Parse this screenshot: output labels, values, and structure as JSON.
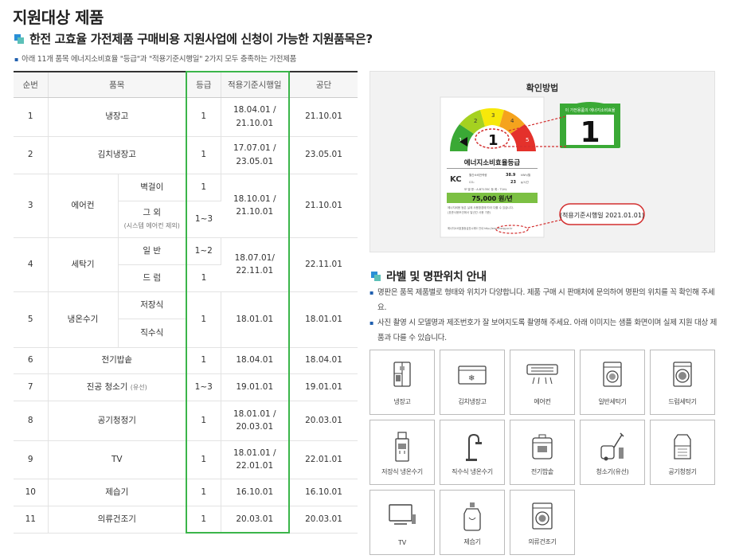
{
  "page": {
    "title": "지원대상 제품",
    "subtitle": "한전 고효율 가전제품 구매비용 지원사업에 신청이 가능한 지원품목은?",
    "note": "아래 11개 품목 에너지소비효율 \"등급\"과 \"적용기준시행일\" 2가지 모두 충족하는 가전제품"
  },
  "table": {
    "headers": [
      "순번",
      "품목",
      "등급",
      "적용기준시행일",
      "공단"
    ],
    "rows": [
      {
        "no": "1",
        "item": "냉장고",
        "grade": "1",
        "date": "18.04.01 / 21.10.01",
        "date1": "18.04.01 /",
        "date2": "21.10.01",
        "agency": "21.10.01"
      },
      {
        "no": "2",
        "item": "김치냉장고",
        "grade": "1",
        "date1": "17.07.01 /",
        "date2": "23.05.01",
        "agency": "23.05.01"
      },
      {
        "no": "3",
        "item": "에어컨",
        "sub1": "벽걸이",
        "sub1_grade": "1",
        "sub2": "그 외",
        "sub2_note": "(시스템 에어컨 제외)",
        "sub2_grade": "1~3",
        "date1": "18.10.01 /",
        "date2": "21.10.01",
        "agency": "21.10.01"
      },
      {
        "no": "4",
        "item": "세탁기",
        "sub1": "일 반",
        "sub1_grade": "1~2",
        "sub2": "드 럼",
        "sub2_grade": "1",
        "date1": "18.07.01/",
        "date2": "22.11.01",
        "agency": "22.11.01"
      },
      {
        "no": "5",
        "item": "냉온수기",
        "sub1": "저장식",
        "sub2": "직수식",
        "grade": "1",
        "date1": "18.01.01",
        "agency": "18.01.01"
      },
      {
        "no": "6",
        "item": "전기밥솥",
        "grade": "1",
        "date1": "18.04.01",
        "agency": "18.04.01"
      },
      {
        "no": "7",
        "item": "진공 청소기",
        "item_note": "(유선)",
        "grade": "1~3",
        "date1": "19.01.01",
        "agency": "19.01.01"
      },
      {
        "no": "8",
        "item": "공기청정기",
        "grade": "1",
        "date1": "18.01.01 /",
        "date2": "20.03.01",
        "agency": "20.03.01"
      },
      {
        "no": "9",
        "item": "TV",
        "grade": "1",
        "date1": "18.01.01 /",
        "date2": "22.01.01",
        "agency": "22.01.01"
      },
      {
        "no": "10",
        "item": "제습기",
        "grade": "1",
        "date1": "16.10.01",
        "agency": "16.10.01"
      },
      {
        "no": "11",
        "item": "의류건조기",
        "grade": "1",
        "date1": "20.03.01",
        "agency": "20.03.01"
      }
    ]
  },
  "check": {
    "title": "확인방법",
    "label_title": "에너지소비효율등급",
    "gauge_numbers": [
      "1",
      "2",
      "3",
      "4",
      "5"
    ],
    "big_grade": "1",
    "zoom_text": "이 가전용품의 에너지소비효율",
    "metric1_label": "월간소비전력량",
    "metric1_value": "38.9",
    "metric1_unit": "kWh/월",
    "metric2_label": "CO₂",
    "metric2_value": "23",
    "metric2_unit": "g/시간",
    "model_row": "모 델 명 : A-B7135C    등 록 : T1HL",
    "cost": "75,000 원/년",
    "fine1": "에너지비용 등은 실제 사용환경에 따라 다를 수 있습니다.",
    "fine2": "(표준사용조건에서 일년간 사용 기준)",
    "footer_text": "에너지소비효율등급표시제도 안내  http://eep.energy.or.kr",
    "callout": "(적용기준시행일 2021.01.01)",
    "kc": "KC",
    "colors": {
      "grade1": "#3aa935",
      "grade2": "#a5d120",
      "grade3": "#f7e80a",
      "grade4": "#f5a31d",
      "grade5": "#e4312b",
      "callout": "#d32f2f"
    }
  },
  "section2": {
    "title": "라벨 및 명판위치 안내",
    "bullets": [
      "명판은 품목 제품별로 형태와 위치가 다양합니다. 제품 구매 시 판매처에 문의하여 명판의 위치를 꼭 확인해 주세요.",
      "사진 촬영 시 모델명과 제조번호가 잘 보여지도록 촬영해 주세요. 아래 이미지는 샘플 화면이며 실제 지원 대상 제품과 다를 수 있습니다."
    ],
    "products": [
      {
        "label": "냉장고",
        "icon": "fridge-icon"
      },
      {
        "label": "김치냉장고",
        "icon": "kimchi-fridge-icon"
      },
      {
        "label": "에어컨",
        "icon": "aircon-icon"
      },
      {
        "label": "일반세탁기",
        "icon": "washer-icon"
      },
      {
        "label": "드럼세탁기",
        "icon": "drum-washer-icon"
      },
      {
        "label": "저장식 냉온수기",
        "icon": "water-dispenser-icon"
      },
      {
        "label": "직수식 냉온수기",
        "icon": "faucet-purifier-icon"
      },
      {
        "label": "전기밥솥",
        "icon": "rice-cooker-icon"
      },
      {
        "label": "청소기(유선)",
        "icon": "vacuum-icon"
      },
      {
        "label": "공기청정기",
        "icon": "air-purifier-icon"
      },
      {
        "label": "TV",
        "icon": "tv-icon"
      },
      {
        "label": "제습기",
        "icon": "dehumidifier-icon"
      },
      {
        "label": "의류건조기",
        "icon": "dryer-icon"
      }
    ]
  }
}
